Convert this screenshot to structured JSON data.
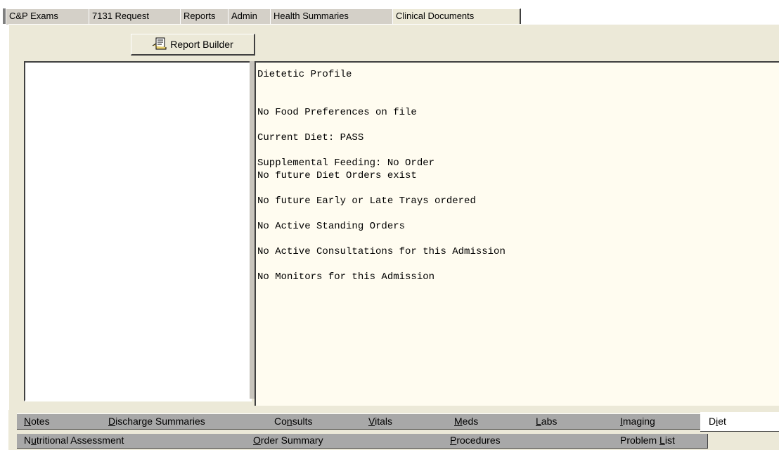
{
  "top_tabs": [
    {
      "label": "C&P Exams"
    },
    {
      "label": "7131 Request"
    },
    {
      "label": "Reports"
    },
    {
      "label": "Admin"
    },
    {
      "label": "Health Summaries"
    },
    {
      "label": "Clinical Documents",
      "active": true
    }
  ],
  "toolbar": {
    "report_builder_label": "Report Builder",
    "report_builder_icon": "report-builder-icon"
  },
  "document": {
    "lines": [
      "Dietetic Profile",
      "",
      "",
      "No Food Preferences on file",
      "",
      "Current Diet: PASS",
      "",
      "Supplemental Feeding: No Order",
      "No future Diet Orders exist",
      "",
      "No future Early or Late Trays ordered",
      "",
      "No Active Standing Orders",
      "",
      "No Active Consultations for this Admission",
      "",
      "No Monitors for this Admission"
    ]
  },
  "bottom_tabs_row1": [
    {
      "label": "Notes",
      "ul": "N",
      "rest": "otes"
    },
    {
      "label": "Discharge Summaries",
      "ul": "D",
      "rest": "ischarge Summaries"
    },
    {
      "label": "Consults",
      "pre": "Co",
      "ul": "n",
      "rest": "sults"
    },
    {
      "label": "Vitals",
      "ul": "V",
      "rest": "itals"
    },
    {
      "label": "Meds",
      "ul": "M",
      "rest": "eds"
    },
    {
      "label": "Labs",
      "ul": "L",
      "rest": "abs"
    },
    {
      "label": "Imaging",
      "ul": "I",
      "rest": "maging"
    },
    {
      "label": "Diet",
      "pre": "D",
      "ul": "i",
      "rest": "et",
      "active": true
    }
  ],
  "bottom_tabs_row2": [
    {
      "label": "Nutritional Assessment",
      "pre": "N",
      "ul": "u",
      "rest": "tritional Assessment"
    },
    {
      "label": "Order Summary",
      "ul": "O",
      "rest": "rder Summary"
    },
    {
      "label": "Procedures",
      "ul": "P",
      "rest": "rocedures"
    },
    {
      "label": "Problem List",
      "pre": "Problem ",
      "ul": "L",
      "rest": "ist"
    }
  ]
}
